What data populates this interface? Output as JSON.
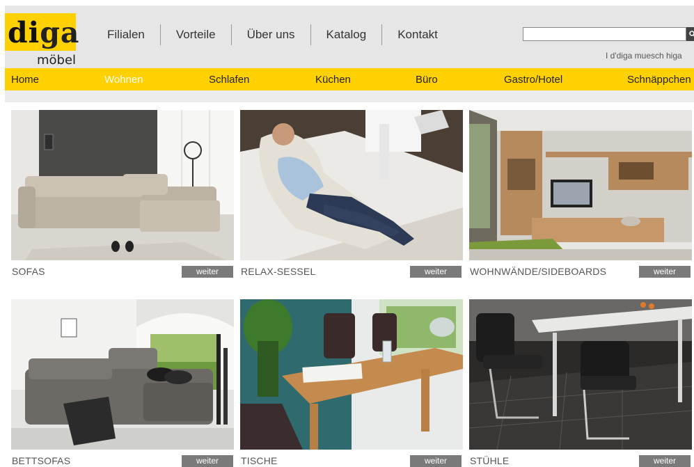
{
  "brand": {
    "logo_main": "diga",
    "logo_di": "di",
    "logo_ga": "ga",
    "logo_sub": "möbel"
  },
  "topnav": [
    "Filialen",
    "Vorteile",
    "Über uns",
    "Katalog",
    "Kontakt"
  ],
  "search": {
    "placeholder": "",
    "value": "",
    "icon": "search-icon"
  },
  "tagline": "I d'diga muesch higa",
  "mainnav": {
    "items": [
      "Home",
      "Wohnen",
      "Schlafen",
      "Küchen",
      "Büro",
      "Gastro/Hotel",
      "Schnäppchen"
    ],
    "active": "Wohnen"
  },
  "colors": {
    "brand_yellow": "#ffd100",
    "header_gray": "#e6e6e6",
    "button_gray": "#7a7a7a"
  },
  "products": [
    {
      "title": "SOFAS",
      "button": "weiter"
    },
    {
      "title": "RELAX-SESSEL",
      "button": "weiter"
    },
    {
      "title": "WOHNWÄNDE/SIDEBOARDS",
      "button": "weiter"
    },
    {
      "title": "BETTSOFAS",
      "button": "weiter"
    },
    {
      "title": "TISCHE",
      "button": "weiter"
    },
    {
      "title": "STÜHLE",
      "button": "weiter"
    }
  ]
}
